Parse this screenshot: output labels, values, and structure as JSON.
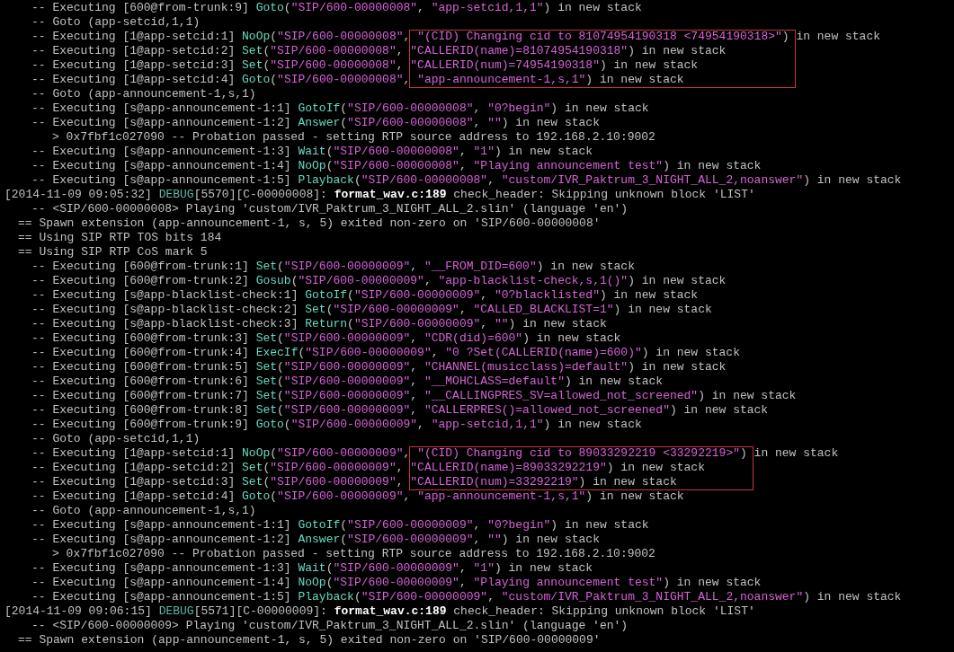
{
  "terminal": {
    "lines": [
      {
        "kind": "verbose",
        "segments": [
          {
            "kind": "plain",
            "text": "-- Executing [600@from-trunk:9] "
          },
          {
            "kind": "app",
            "text": "Goto"
          },
          {
            "kind": "plain",
            "text": "("
          },
          {
            "kind": "string",
            "text": "\"SIP/600-00000008\""
          },
          {
            "kind": "plain",
            "text": ", "
          },
          {
            "kind": "string",
            "text": "\"app-setcid,1,1\""
          },
          {
            "kind": "plain",
            "text": ") in new stack"
          }
        ]
      },
      {
        "kind": "verbose",
        "segments": [
          {
            "kind": "plain",
            "text": "-- Goto (app-setcid,1,1)"
          }
        ]
      },
      {
        "kind": "verbose",
        "segments": [
          {
            "kind": "plain",
            "text": "-- Executing [1@app-setcid:1] "
          },
          {
            "kind": "app",
            "text": "NoOp"
          },
          {
            "kind": "plain",
            "text": "("
          },
          {
            "kind": "string",
            "text": "\"SIP/600-00000008\""
          },
          {
            "kind": "plain",
            "text": ", "
          },
          {
            "kind": "mark_string",
            "text": "\"(CID) Changing cid to 81074954190318 <74954190318>\""
          },
          {
            "kind": "mark_plain",
            "text": ")"
          },
          {
            "kind": "plain",
            "text": " in new stack"
          }
        ]
      },
      {
        "kind": "verbose",
        "segments": [
          {
            "kind": "plain",
            "text": "-- Executing [1@app-setcid:2] "
          },
          {
            "kind": "app",
            "text": "Set"
          },
          {
            "kind": "plain",
            "text": "("
          },
          {
            "kind": "string",
            "text": "\"SIP/600-00000008\""
          },
          {
            "kind": "plain",
            "text": ", "
          },
          {
            "kind": "mark_string",
            "text": "\"CALLERID(name)=81074954190318\""
          },
          {
            "kind": "plain",
            "text": ") in new stack"
          }
        ]
      },
      {
        "kind": "verbose",
        "segments": [
          {
            "kind": "plain",
            "text": "-- Executing [1@app-setcid:3] "
          },
          {
            "kind": "app",
            "text": "Set"
          },
          {
            "kind": "plain",
            "text": "("
          },
          {
            "kind": "string",
            "text": "\"SIP/600-00000008\""
          },
          {
            "kind": "plain",
            "text": ", "
          },
          {
            "kind": "mark_string",
            "text": "\"CALLERID(num)=74954190318\""
          },
          {
            "kind": "plain",
            "text": ") in new stack"
          }
        ]
      },
      {
        "kind": "verbose",
        "segments": [
          {
            "kind": "plain",
            "text": "-- Executing [1@app-setcid:4] "
          },
          {
            "kind": "app",
            "text": "Goto"
          },
          {
            "kind": "plain",
            "text": "("
          },
          {
            "kind": "string",
            "text": "\"SIP/600-00000008\""
          },
          {
            "kind": "plain",
            "text": ", "
          },
          {
            "kind": "mark_string",
            "text": "\"app-announcement-1,s,1\""
          },
          {
            "kind": "plain",
            "text": ") in new stack"
          }
        ]
      },
      {
        "kind": "verbose",
        "segments": [
          {
            "kind": "plain",
            "text": "-- Goto (app-announcement-1,s,1)"
          }
        ]
      },
      {
        "kind": "verbose",
        "segments": [
          {
            "kind": "plain",
            "text": "-- Executing [s@app-announcement-1:1] "
          },
          {
            "kind": "app",
            "text": "GotoIf"
          },
          {
            "kind": "plain",
            "text": "("
          },
          {
            "kind": "string",
            "text": "\"SIP/600-00000008\""
          },
          {
            "kind": "plain",
            "text": ", "
          },
          {
            "kind": "string",
            "text": "\"0?begin\""
          },
          {
            "kind": "plain",
            "text": ") in new stack"
          }
        ]
      },
      {
        "kind": "verbose",
        "segments": [
          {
            "kind": "plain",
            "text": "-- Executing [s@app-announcement-1:2] "
          },
          {
            "kind": "app",
            "text": "Answer"
          },
          {
            "kind": "plain",
            "text": "("
          },
          {
            "kind": "string",
            "text": "\"SIP/600-00000008\""
          },
          {
            "kind": "plain",
            "text": ", "
          },
          {
            "kind": "string",
            "text": "\"\""
          },
          {
            "kind": "plain",
            "text": ") in new stack"
          }
        ]
      },
      {
        "kind": "detail",
        "segments": [
          {
            "kind": "plain",
            "text": "> 0x7fbf1c027090 -- Probation passed - setting RTP source address to 192.168.2.10:9002"
          }
        ]
      },
      {
        "kind": "verbose",
        "segments": [
          {
            "kind": "plain",
            "text": "-- Executing [s@app-announcement-1:3] "
          },
          {
            "kind": "app",
            "text": "Wait"
          },
          {
            "kind": "plain",
            "text": "("
          },
          {
            "kind": "string",
            "text": "\"SIP/600-00000008\""
          },
          {
            "kind": "plain",
            "text": ", "
          },
          {
            "kind": "string",
            "text": "\"1\""
          },
          {
            "kind": "plain",
            "text": ") in new stack"
          }
        ]
      },
      {
        "kind": "verbose",
        "segments": [
          {
            "kind": "plain",
            "text": "-- Executing [s@app-announcement-1:4] "
          },
          {
            "kind": "app",
            "text": "NoOp"
          },
          {
            "kind": "plain",
            "text": "("
          },
          {
            "kind": "string",
            "text": "\"SIP/600-00000008\""
          },
          {
            "kind": "plain",
            "text": ", "
          },
          {
            "kind": "string",
            "text": "\"Playing announcement test\""
          },
          {
            "kind": "plain",
            "text": ") in new stack"
          }
        ]
      },
      {
        "kind": "verbose",
        "segments": [
          {
            "kind": "plain",
            "text": "-- Executing [s@app-announcement-1:5] "
          },
          {
            "kind": "app",
            "text": "Playback"
          },
          {
            "kind": "plain",
            "text": "("
          },
          {
            "kind": "string",
            "text": "\"SIP/600-00000008\""
          },
          {
            "kind": "plain",
            "text": ", "
          },
          {
            "kind": "string",
            "text": "\"custom/IVR_Paktrum_3_NIGHT_ALL_2,noanswer\""
          },
          {
            "kind": "plain",
            "text": ") in new stack"
          }
        ]
      },
      {
        "kind": "log",
        "segments": [
          {
            "kind": "plain",
            "text": "[2014-11-09 09:05:32] "
          },
          {
            "kind": "debug",
            "text": "DEBUG"
          },
          {
            "kind": "plain",
            "text": "[5570][C-00000008]: "
          },
          {
            "kind": "bright",
            "text": "format_wav.c:189"
          },
          {
            "kind": "plain",
            "text": " check_header: Skipping unknown block 'LIST'"
          }
        ]
      },
      {
        "kind": "verbose",
        "segments": [
          {
            "kind": "plain",
            "text": "-- <SIP/600-00000008> Playing 'custom/IVR_Paktrum_3_NIGHT_ALL_2.slin' (language 'en')"
          }
        ]
      },
      {
        "kind": "notice",
        "segments": [
          {
            "kind": "plain",
            "text": "== Spawn extension (app-announcement-1, s, 5) exited non-zero on 'SIP/600-00000008'"
          }
        ]
      },
      {
        "kind": "notice",
        "segments": [
          {
            "kind": "plain",
            "text": "== Using SIP RTP TOS bits 184"
          }
        ]
      },
      {
        "kind": "notice",
        "segments": [
          {
            "kind": "plain",
            "text": "== Using SIP RTP CoS mark 5"
          }
        ]
      },
      {
        "kind": "verbose",
        "segments": [
          {
            "kind": "plain",
            "text": "-- Executing [600@from-trunk:1] "
          },
          {
            "kind": "app",
            "text": "Set"
          },
          {
            "kind": "plain",
            "text": "("
          },
          {
            "kind": "string",
            "text": "\"SIP/600-00000009\""
          },
          {
            "kind": "plain",
            "text": ", "
          },
          {
            "kind": "string",
            "text": "\"__FROM_DID=600\""
          },
          {
            "kind": "plain",
            "text": ") in new stack"
          }
        ]
      },
      {
        "kind": "verbose",
        "segments": [
          {
            "kind": "plain",
            "text": "-- Executing [600@from-trunk:2] "
          },
          {
            "kind": "app",
            "text": "Gosub"
          },
          {
            "kind": "plain",
            "text": "("
          },
          {
            "kind": "string",
            "text": "\"SIP/600-00000009\""
          },
          {
            "kind": "plain",
            "text": ", "
          },
          {
            "kind": "string",
            "text": "\"app-blacklist-check,s,1()\""
          },
          {
            "kind": "plain",
            "text": ") in new stack"
          }
        ]
      },
      {
        "kind": "verbose",
        "segments": [
          {
            "kind": "plain",
            "text": "-- Executing [s@app-blacklist-check:1] "
          },
          {
            "kind": "app",
            "text": "GotoIf"
          },
          {
            "kind": "plain",
            "text": "("
          },
          {
            "kind": "string",
            "text": "\"SIP/600-00000009\""
          },
          {
            "kind": "plain",
            "text": ", "
          },
          {
            "kind": "string",
            "text": "\"0?blacklisted\""
          },
          {
            "kind": "plain",
            "text": ") in new stack"
          }
        ]
      },
      {
        "kind": "verbose",
        "segments": [
          {
            "kind": "plain",
            "text": "-- Executing [s@app-blacklist-check:2] "
          },
          {
            "kind": "app",
            "text": "Set"
          },
          {
            "kind": "plain",
            "text": "("
          },
          {
            "kind": "string",
            "text": "\"SIP/600-00000009\""
          },
          {
            "kind": "plain",
            "text": ", "
          },
          {
            "kind": "string",
            "text": "\"CALLED_BLACKLIST=1\""
          },
          {
            "kind": "plain",
            "text": ") in new stack"
          }
        ]
      },
      {
        "kind": "verbose",
        "segments": [
          {
            "kind": "plain",
            "text": "-- Executing [s@app-blacklist-check:3] "
          },
          {
            "kind": "app",
            "text": "Return"
          },
          {
            "kind": "plain",
            "text": "("
          },
          {
            "kind": "string",
            "text": "\"SIP/600-00000009\""
          },
          {
            "kind": "plain",
            "text": ", "
          },
          {
            "kind": "string",
            "text": "\"\""
          },
          {
            "kind": "plain",
            "text": ") in new stack"
          }
        ]
      },
      {
        "kind": "verbose",
        "segments": [
          {
            "kind": "plain",
            "text": "-- Executing [600@from-trunk:3] "
          },
          {
            "kind": "app",
            "text": "Set"
          },
          {
            "kind": "plain",
            "text": "("
          },
          {
            "kind": "string",
            "text": "\"SIP/600-00000009\""
          },
          {
            "kind": "plain",
            "text": ", "
          },
          {
            "kind": "string",
            "text": "\"CDR(did)=600\""
          },
          {
            "kind": "plain",
            "text": ") in new stack"
          }
        ]
      },
      {
        "kind": "verbose",
        "segments": [
          {
            "kind": "plain",
            "text": "-- Executing [600@from-trunk:4] "
          },
          {
            "kind": "app",
            "text": "ExecIf"
          },
          {
            "kind": "plain",
            "text": "("
          },
          {
            "kind": "string",
            "text": "\"SIP/600-00000009\""
          },
          {
            "kind": "plain",
            "text": ", "
          },
          {
            "kind": "string",
            "text": "\"0 ?Set(CALLERID(name)=600)\""
          },
          {
            "kind": "plain",
            "text": ") in new stack"
          }
        ]
      },
      {
        "kind": "verbose",
        "segments": [
          {
            "kind": "plain",
            "text": "-- Executing [600@from-trunk:5] "
          },
          {
            "kind": "app",
            "text": "Set"
          },
          {
            "kind": "plain",
            "text": "("
          },
          {
            "kind": "string",
            "text": "\"SIP/600-00000009\""
          },
          {
            "kind": "plain",
            "text": ", "
          },
          {
            "kind": "string",
            "text": "\"CHANNEL(musicclass)=default\""
          },
          {
            "kind": "plain",
            "text": ") in new stack"
          }
        ]
      },
      {
        "kind": "verbose",
        "segments": [
          {
            "kind": "plain",
            "text": "-- Executing [600@from-trunk:6] "
          },
          {
            "kind": "app",
            "text": "Set"
          },
          {
            "kind": "plain",
            "text": "("
          },
          {
            "kind": "string",
            "text": "\"SIP/600-00000009\""
          },
          {
            "kind": "plain",
            "text": ", "
          },
          {
            "kind": "string",
            "text": "\"__MOHCLASS=default\""
          },
          {
            "kind": "plain",
            "text": ") in new stack"
          }
        ]
      },
      {
        "kind": "verbose",
        "segments": [
          {
            "kind": "plain",
            "text": "-- Executing [600@from-trunk:7] "
          },
          {
            "kind": "app",
            "text": "Set"
          },
          {
            "kind": "plain",
            "text": "("
          },
          {
            "kind": "string",
            "text": "\"SIP/600-00000009\""
          },
          {
            "kind": "plain",
            "text": ", "
          },
          {
            "kind": "string",
            "text": "\"__CALLINGPRES_SV=allowed_not_screened\""
          },
          {
            "kind": "plain",
            "text": ") in new stack"
          }
        ]
      },
      {
        "kind": "verbose",
        "segments": [
          {
            "kind": "plain",
            "text": "-- Executing [600@from-trunk:8] "
          },
          {
            "kind": "app",
            "text": "Set"
          },
          {
            "kind": "plain",
            "text": "("
          },
          {
            "kind": "string",
            "text": "\"SIP/600-00000009\""
          },
          {
            "kind": "plain",
            "text": ", "
          },
          {
            "kind": "string",
            "text": "\"CALLERPRES()=allowed_not_screened\""
          },
          {
            "kind": "plain",
            "text": ") in new stack"
          }
        ]
      },
      {
        "kind": "verbose",
        "segments": [
          {
            "kind": "plain",
            "text": "-- Executing [600@from-trunk:9] "
          },
          {
            "kind": "app",
            "text": "Goto"
          },
          {
            "kind": "plain",
            "text": "("
          },
          {
            "kind": "string",
            "text": "\"SIP/600-00000009\""
          },
          {
            "kind": "plain",
            "text": ", "
          },
          {
            "kind": "string",
            "text": "\"app-setcid,1,1\""
          },
          {
            "kind": "plain",
            "text": ") in new stack"
          }
        ]
      },
      {
        "kind": "verbose",
        "segments": [
          {
            "kind": "plain",
            "text": "-- Goto (app-setcid,1,1)"
          }
        ]
      },
      {
        "kind": "verbose",
        "segments": [
          {
            "kind": "plain",
            "text": "-- Executing [1@app-setcid:1] "
          },
          {
            "kind": "app",
            "text": "NoOp"
          },
          {
            "kind": "plain",
            "text": "("
          },
          {
            "kind": "string",
            "text": "\"SIP/600-00000009\""
          },
          {
            "kind": "plain",
            "text": ", "
          },
          {
            "kind": "mark_string",
            "text": "\"(CID) Changing cid to 89033292219 <33292219>\""
          },
          {
            "kind": "mark_plain",
            "text": ")"
          },
          {
            "kind": "plain",
            "text": " in new stack"
          }
        ]
      },
      {
        "kind": "verbose",
        "segments": [
          {
            "kind": "plain",
            "text": "-- Executing [1@app-setcid:2] "
          },
          {
            "kind": "app",
            "text": "Set"
          },
          {
            "kind": "plain",
            "text": "("
          },
          {
            "kind": "string",
            "text": "\"SIP/600-00000009\""
          },
          {
            "kind": "plain",
            "text": ", "
          },
          {
            "kind": "mark_string",
            "text": "\"CALLERID(name)=89033292219\""
          },
          {
            "kind": "plain",
            "text": ") in new stack"
          }
        ]
      },
      {
        "kind": "verbose",
        "segments": [
          {
            "kind": "plain",
            "text": "-- Executing [1@app-setcid:3] "
          },
          {
            "kind": "app",
            "text": "Set"
          },
          {
            "kind": "plain",
            "text": "("
          },
          {
            "kind": "string",
            "text": "\"SIP/600-00000009\""
          },
          {
            "kind": "plain",
            "text": ", "
          },
          {
            "kind": "mark_string",
            "text": "\"CALLERID(num)=33292219\""
          },
          {
            "kind": "plain",
            "text": ") in new stack"
          }
        ]
      },
      {
        "kind": "verbose",
        "segments": [
          {
            "kind": "plain",
            "text": "-- Executing [1@app-setcid:4] "
          },
          {
            "kind": "app",
            "text": "Goto"
          },
          {
            "kind": "plain",
            "text": "("
          },
          {
            "kind": "string",
            "text": "\"SIP/600-00000009\""
          },
          {
            "kind": "plain",
            "text": ", "
          },
          {
            "kind": "string",
            "text": "\"app-announcement-1,s,1\""
          },
          {
            "kind": "plain",
            "text": ") in new stack"
          }
        ]
      },
      {
        "kind": "verbose",
        "segments": [
          {
            "kind": "plain",
            "text": "-- Goto (app-announcement-1,s,1)"
          }
        ]
      },
      {
        "kind": "verbose",
        "segments": [
          {
            "kind": "plain",
            "text": "-- Executing [s@app-announcement-1:1] "
          },
          {
            "kind": "app",
            "text": "GotoIf"
          },
          {
            "kind": "plain",
            "text": "("
          },
          {
            "kind": "string",
            "text": "\"SIP/600-00000009\""
          },
          {
            "kind": "plain",
            "text": ", "
          },
          {
            "kind": "string",
            "text": "\"0?begin\""
          },
          {
            "kind": "plain",
            "text": ") in new stack"
          }
        ]
      },
      {
        "kind": "verbose",
        "segments": [
          {
            "kind": "plain",
            "text": "-- Executing [s@app-announcement-1:2] "
          },
          {
            "kind": "app",
            "text": "Answer"
          },
          {
            "kind": "plain",
            "text": "("
          },
          {
            "kind": "string",
            "text": "\"SIP/600-00000009\""
          },
          {
            "kind": "plain",
            "text": ", "
          },
          {
            "kind": "string",
            "text": "\"\""
          },
          {
            "kind": "plain",
            "text": ") in new stack"
          }
        ]
      },
      {
        "kind": "detail",
        "segments": [
          {
            "kind": "plain",
            "text": "> 0x7fbf1c027090 -- Probation passed - setting RTP source address to 192.168.2.10:9002"
          }
        ]
      },
      {
        "kind": "verbose",
        "segments": [
          {
            "kind": "plain",
            "text": "-- Executing [s@app-announcement-1:3] "
          },
          {
            "kind": "app",
            "text": "Wait"
          },
          {
            "kind": "plain",
            "text": "("
          },
          {
            "kind": "string",
            "text": "\"SIP/600-00000009\""
          },
          {
            "kind": "plain",
            "text": ", "
          },
          {
            "kind": "string",
            "text": "\"1\""
          },
          {
            "kind": "plain",
            "text": ") in new stack"
          }
        ]
      },
      {
        "kind": "verbose",
        "segments": [
          {
            "kind": "plain",
            "text": "-- Executing [s@app-announcement-1:4] "
          },
          {
            "kind": "app",
            "text": "NoOp"
          },
          {
            "kind": "plain",
            "text": "("
          },
          {
            "kind": "string",
            "text": "\"SIP/600-00000009\""
          },
          {
            "kind": "plain",
            "text": ", "
          },
          {
            "kind": "string",
            "text": "\"Playing announcement test\""
          },
          {
            "kind": "plain",
            "text": ") in new stack"
          }
        ]
      },
      {
        "kind": "verbose",
        "segments": [
          {
            "kind": "plain",
            "text": "-- Executing [s@app-announcement-1:5] "
          },
          {
            "kind": "app",
            "text": "Playback"
          },
          {
            "kind": "plain",
            "text": "("
          },
          {
            "kind": "string",
            "text": "\"SIP/600-00000009\""
          },
          {
            "kind": "plain",
            "text": ", "
          },
          {
            "kind": "string",
            "text": "\"custom/IVR_Paktrum_3_NIGHT_ALL_2,noanswer\""
          },
          {
            "kind": "plain",
            "text": ") in new stack"
          }
        ]
      },
      {
        "kind": "log",
        "segments": [
          {
            "kind": "plain",
            "text": "[2014-11-09 09:06:15] "
          },
          {
            "kind": "debug",
            "text": "DEBUG"
          },
          {
            "kind": "plain",
            "text": "[5571][C-00000009]: "
          },
          {
            "kind": "bright",
            "text": "format_wav.c:189"
          },
          {
            "kind": "plain",
            "text": " check_header: Skipping unknown block 'LIST'"
          }
        ]
      },
      {
        "kind": "verbose",
        "segments": [
          {
            "kind": "plain",
            "text": "-- <SIP/600-00000009> Playing 'custom/IVR_Paktrum_3_NIGHT_ALL_2.slin' (language 'en')"
          }
        ]
      },
      {
        "kind": "notice",
        "segments": [
          {
            "kind": "plain",
            "text": "== Spawn extension (app-announcement-1, s, 5) exited non-zero on 'SIP/600-00000009'"
          }
        ]
      }
    ]
  }
}
